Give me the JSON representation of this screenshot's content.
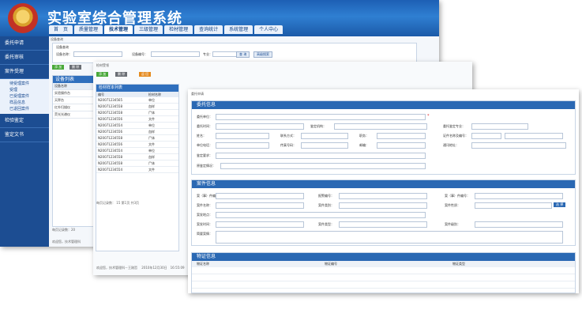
{
  "app": {
    "title": "实验室综合管理系统"
  },
  "topnav": [
    "首　页",
    "质量管理",
    "技术管理",
    "三级管理",
    "检材管理",
    "查询统计",
    "系统管理",
    "个人中心"
  ],
  "sidebar": {
    "items": [
      "委托申请",
      "委托审核",
      "案件受理"
    ],
    "subitems": [
      "待受理案件",
      "受理",
      "已受理案件",
      "样品信息",
      "已退回案件"
    ],
    "items_after": [
      "检验鉴定",
      "鉴定文书"
    ]
  },
  "win1": {
    "crumb": "设备查询",
    "form": {
      "label_group": "设备查询",
      "label_name": "设备名称：",
      "label_no": "设备编号：",
      "label_major": "专业：",
      "btn_query": "查 询",
      "btn_adv": "高级搜索"
    },
    "buttons": [
      "添 加",
      "删 除"
    ],
    "panel_title": "设备列表",
    "header": "设备名称",
    "rows": [
      "实验操作台",
      "天秤台",
      "红外扫描仪",
      "荧光光谱仪"
    ],
    "pager": "每页记录数：",
    "pager_value": "20",
    "footer": "欢迎您，技术管理科"
  },
  "win2": {
    "crumb": "检材受领",
    "buttons": [
      "添 加",
      "删 除",
      "返 回"
    ],
    "table_title": "检材样本列表",
    "col1": "编号",
    "col2": "检材名称",
    "rows": [
      {
        "no": "N20071234565",
        "name": "单位"
      },
      {
        "no": "N20071234558",
        "name": "血样"
      },
      {
        "no": "N20071234558",
        "name": "尸体"
      },
      {
        "no": "N20071234556",
        "name": "文件"
      },
      {
        "no": "N20071234554",
        "name": "单位"
      },
      {
        "no": "N20071234556",
        "name": "血样"
      },
      {
        "no": "N20071234558",
        "name": "尸体"
      },
      {
        "no": "N20071234556",
        "name": "文件"
      },
      {
        "no": "N20071234554",
        "name": "单位"
      },
      {
        "no": "N20071234558",
        "name": "血样"
      },
      {
        "no": "N20071234558",
        "name": "尸体"
      },
      {
        "no": "N20071234554",
        "name": "文件"
      }
    ],
    "pager": "每页记录数：",
    "pager_value": "15",
    "pager_page": "第1页",
    "pager_total": "共3页",
    "footer": "欢迎您，技术管理科－王刚哲",
    "footer_date": "2010年12月30日　16:55:09"
  },
  "win3": {
    "crumb": "委托申请",
    "sec1": {
      "title": "委托信息",
      "f1": "委托单位：",
      "f2": "委托时间：",
      "f3": "鉴定机构：",
      "f4": "委托鉴定专业：",
      "f5": "姓名：",
      "f6": "联系方式：",
      "f7": "职务：",
      "f8": "证件名称及编号：",
      "f9": "单位电话：",
      "f10": "传真号码：",
      "f11": "邮编：",
      "f12": "通讯地址：",
      "f13": "鉴定要求：",
      "f14": "原鉴定情况："
    },
    "sec2": {
      "title": "案件信息",
      "f1": "案（事）件编号：",
      "f2": "报警编号：",
      "f3": "案（事）件编号：",
      "f4": "案件名称：",
      "f5": "案件类别：",
      "f6": "案件性质：",
      "btn_select": "选 择",
      "f7": "案发地点：",
      "f8": "案发时间：",
      "f9": "案件类型：",
      "f10": "案件级别：",
      "f11": "简要案情："
    },
    "sec3": {
      "title": "物证信息",
      "col1": "物证名称",
      "col2": "物证编号",
      "col3": "物证类型"
    }
  },
  "colors": {
    "banner": "#1d5fb4",
    "sidebar": "#1c4d92",
    "section_header": "#2a68b3",
    "btn_green": "#4aa93a",
    "btn_gray": "#6b6f75",
    "btn_orange": "#e58a1e",
    "required": "#dd2222"
  }
}
